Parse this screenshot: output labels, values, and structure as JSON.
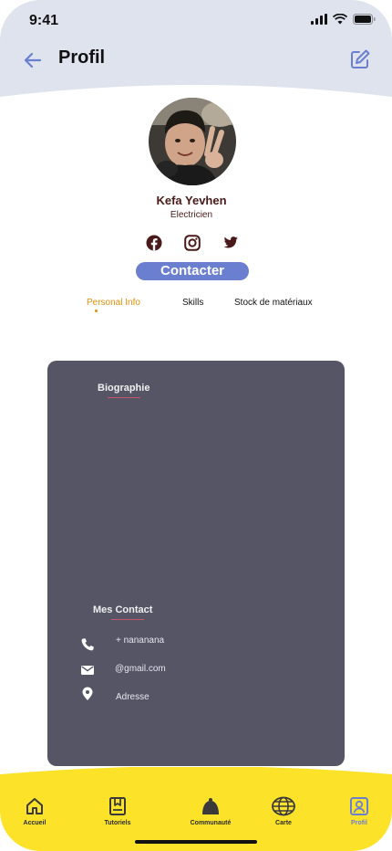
{
  "status_bar": {
    "time": "9:41"
  },
  "header": {
    "title": "Profil"
  },
  "profile": {
    "name": "Kefa Yevhen",
    "job": "Electricien"
  },
  "social": {
    "facebook": "facebook-icon",
    "instagram": "instagram-icon",
    "twitter": "twitter-icon"
  },
  "contact_button": "Contacter",
  "tabs": [
    {
      "label": "Personal Info",
      "active": true
    },
    {
      "label": "Skills",
      "active": false
    },
    {
      "label": "Stock de matériaux",
      "active": false
    }
  ],
  "card": {
    "bio_title": "Biographie",
    "contact_title": "Mes Contact",
    "contacts": [
      {
        "icon": "phone-icon",
        "text": "+ nananana"
      },
      {
        "icon": "mail-icon",
        "text": "@gmail.com"
      },
      {
        "icon": "location-icon",
        "text": "Adresse"
      }
    ]
  },
  "nav": [
    {
      "label": "Accueil",
      "icon": "home-icon"
    },
    {
      "label": "Tutoriels",
      "icon": "book-icon"
    },
    {
      "label": "Communauté",
      "icon": "bell-icon"
    },
    {
      "label": "Carte",
      "icon": "globe-icon"
    },
    {
      "label": "Profil",
      "icon": "profile-icon",
      "active": true
    }
  ],
  "colors": {
    "accent": "#6b7fd1",
    "header_bg": "#dfe3ee",
    "nav_bg": "#fde22a",
    "card_bg": "#555566",
    "tab_active": "#e0900a"
  }
}
